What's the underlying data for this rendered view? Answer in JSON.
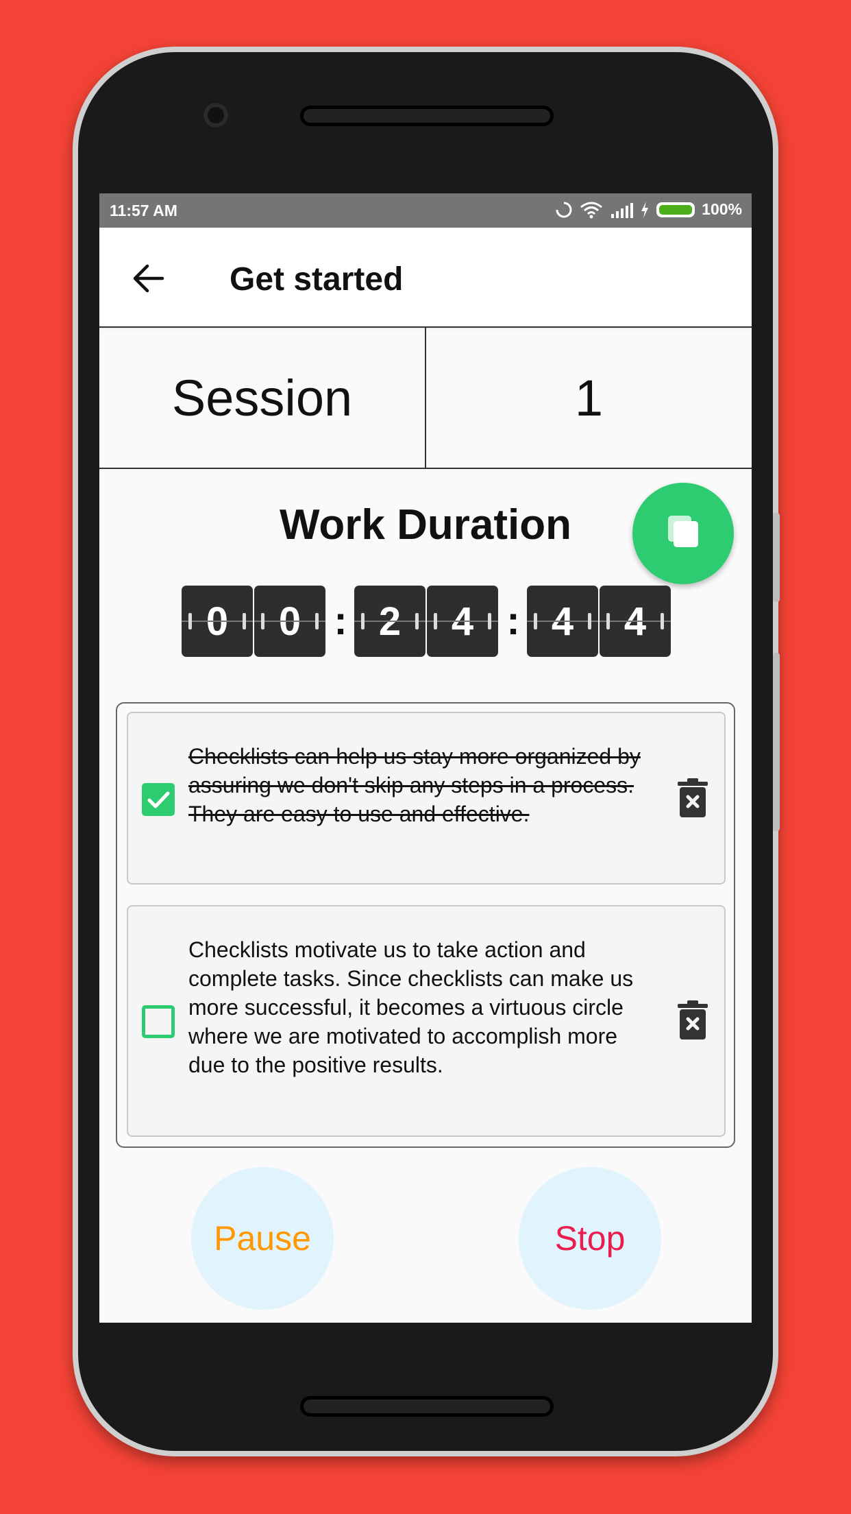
{
  "status_bar": {
    "time": "11:57 AM",
    "battery_percent": "100%",
    "battery_level": 1.0
  },
  "app_bar": {
    "title": "Get started"
  },
  "session": {
    "label": "Session",
    "value": "1"
  },
  "timer": {
    "title": "Work Duration",
    "digits": [
      "0",
      "0",
      "2",
      "4",
      "4",
      "4"
    ],
    "separator": ":"
  },
  "checklist": {
    "items": [
      {
        "text": "Checklists can help us stay more organized by assuring we don't skip any steps in a process. They are easy to use and effective.",
        "checked": true
      },
      {
        "text": "Checklists motivate us to take action and complete tasks. Since checklists can make us more successful, it becomes a virtuous circle where we are motivated to accomplish more due to the positive results.",
        "checked": false
      }
    ]
  },
  "actions": {
    "pause_label": "Pause",
    "stop_label": "Stop"
  },
  "colors": {
    "background": "#f44336",
    "accent_green": "#2ecc71",
    "pause": "#ff9800",
    "stop": "#e91e4f",
    "button_bg": "#e1f3fc"
  },
  "icons": [
    "back-arrow-icon",
    "sync-icon",
    "wifi-icon",
    "signal-icon",
    "charging-icon",
    "battery-icon",
    "copy-icon",
    "check-icon",
    "trash-icon"
  ]
}
